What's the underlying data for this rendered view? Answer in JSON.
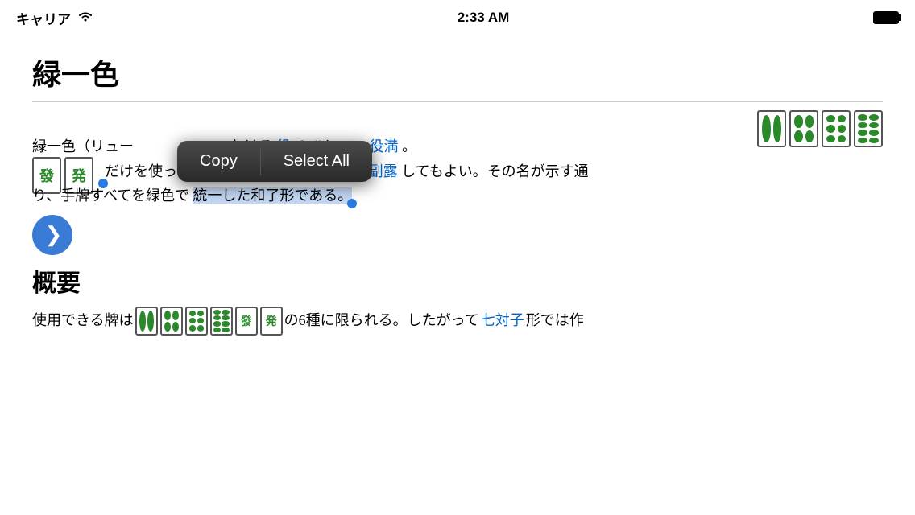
{
  "statusBar": {
    "carrier": "キャリア",
    "wifi": "wifi",
    "time": "2:33 AM",
    "battery": "battery"
  },
  "page": {
    "title": "緑一色",
    "content": {
      "intro": "緑一色（リュー",
      "intro2": "おける",
      "role_link": "役",
      "intro3": "のひとつ。",
      "yakuman_link": "役満",
      "intro4": "。",
      "line2_pre": "だけを使って和了ったときに成立する。",
      "fukuro_link": "副露",
      "line2_post": "してもよい。その名が示す通",
      "line3": "り、手牌すべてを緑色で",
      "selected_text": "統一した和了形である。",
      "section_heading": "概要",
      "bottom_pre": "使用できる牌は",
      "bottom_mid": "の6種に限られる。したがって",
      "shichitaishi_link": "七対子",
      "bottom_post": "形では作"
    }
  },
  "contextMenu": {
    "copy_label": "Copy",
    "selectAll_label": "Select All"
  },
  "tiles": {
    "top_right": [
      "2-bamboo",
      "4-bamboo",
      "6-bamboo",
      "8-bamboo"
    ],
    "side_left": [
      "hatsu-char",
      "hatsu-char2"
    ],
    "bottom_row": [
      "2-bamboo-sm",
      "4-bamboo-sm",
      "6-bamboo-sm",
      "8-bamboo-sm",
      "hatsu-sm",
      "hatsu2-sm"
    ]
  }
}
